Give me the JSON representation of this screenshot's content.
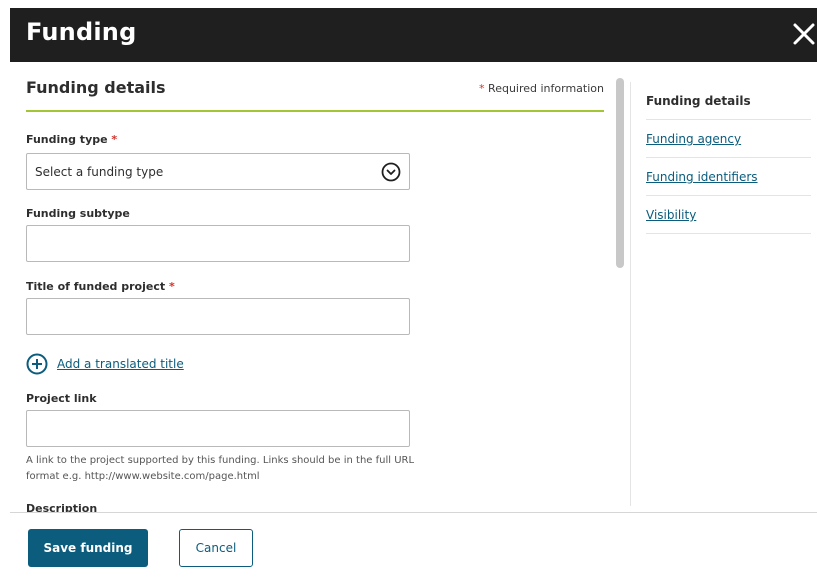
{
  "dialog": {
    "title": "Funding",
    "close_icon": "close-icon"
  },
  "section": {
    "title": "Funding details",
    "required_marker": "*",
    "required_text": "Required information"
  },
  "form": {
    "funding_type": {
      "label": "Funding type",
      "required_marker": "*",
      "selected_value": "Select a funding type",
      "icon": "chevron-down-circle-icon"
    },
    "funding_subtype": {
      "label": "Funding subtype",
      "value": ""
    },
    "title_of_project": {
      "label": "Title of funded project",
      "required_marker": "*",
      "value": ""
    },
    "add_translated_title": {
      "label": "Add a translated title",
      "icon": "plus-circle-icon"
    },
    "project_link": {
      "label": "Project link",
      "value": "",
      "help_text": "A link to the project supported by this funding. Links should be in the full URL format e.g. http://www.website.com/page.html"
    },
    "description": {
      "label": "Description",
      "value": ""
    }
  },
  "nav": {
    "items": [
      {
        "label": "Funding details",
        "active": true
      },
      {
        "label": "Funding agency",
        "active": false
      },
      {
        "label": "Funding identifiers",
        "active": false
      },
      {
        "label": "Visibility",
        "active": false
      }
    ]
  },
  "footer": {
    "save_label": "Save funding",
    "cancel_label": "Cancel"
  },
  "colors": {
    "header_bg": "#1f1f1f",
    "accent_line": "#a3c635",
    "primary_button": "#0b5c7d",
    "link": "#0b5c7d",
    "required_star": "#d0342c"
  }
}
